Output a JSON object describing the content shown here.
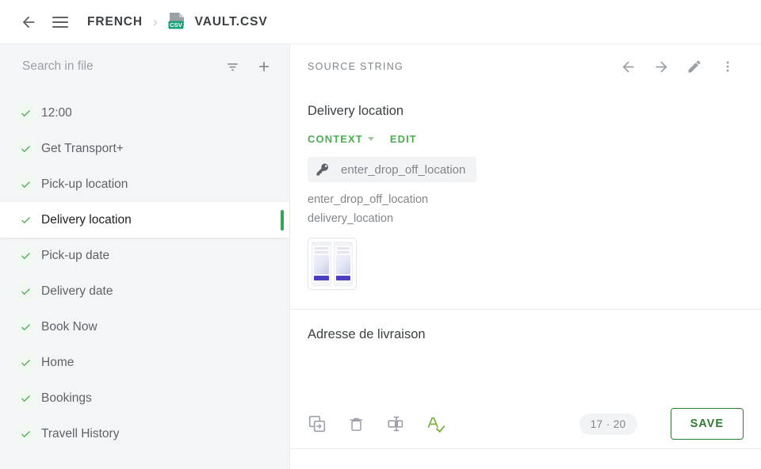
{
  "colors": {
    "accent_green": "#34a853",
    "context_green": "#4caf50",
    "save_green": "#2e7d32",
    "sidebar_bg": "#f4f5f7",
    "text_primary": "#3c4043",
    "text_secondary": "#80868b",
    "csv_badge": "#1aa179",
    "phone_button_purple": "#4a3fc4"
  },
  "topbar": {
    "back_icon": "back-arrow-icon",
    "menu_icon": "hamburger-menu-icon",
    "breadcrumb": {
      "project": "FRENCH",
      "separator": "›",
      "file": "VAULT.CSV",
      "file_icon": "csv-file-icon",
      "file_icon_badge": "CSV"
    }
  },
  "sidebar": {
    "search": {
      "placeholder": "Search in file",
      "value": ""
    },
    "filter_icon": "filter-icon",
    "add_icon": "plus-icon",
    "items": [
      {
        "label": "12:00",
        "status": "translated",
        "selected": false
      },
      {
        "label": "Get Transport+",
        "status": "translated",
        "selected": false
      },
      {
        "label": "Pick-up location",
        "status": "translated",
        "selected": false
      },
      {
        "label": "Delivery location",
        "status": "translated",
        "selected": true
      },
      {
        "label": "Pick-up date",
        "status": "translated",
        "selected": false
      },
      {
        "label": "Delivery date",
        "status": "translated",
        "selected": false
      },
      {
        "label": "Book Now",
        "status": "translated",
        "selected": false
      },
      {
        "label": "Home",
        "status": "translated",
        "selected": false
      },
      {
        "label": "Bookings",
        "status": "translated",
        "selected": false
      },
      {
        "label": "Travell History",
        "status": "translated",
        "selected": false
      }
    ]
  },
  "source_panel": {
    "caption": "SOURCE STRING",
    "prev_icon": "arrow-left-icon",
    "next_icon": "arrow-right-icon",
    "edit_icon": "pencil-icon",
    "more_icon": "more-vertical-icon",
    "string": "Delivery location",
    "context": {
      "label": "CONTEXT",
      "caret_icon": "chevron-down-icon",
      "edit_label": "EDIT",
      "key_icon": "key-icon",
      "key_name": "enter_drop_off_location",
      "meta_lines": [
        "enter_drop_off_location",
        "delivery_location"
      ],
      "screenshot_thumbnail": "screenshot-thumbnail"
    }
  },
  "translation_panel": {
    "text": "Adresse de livraison",
    "tools": [
      {
        "name": "copy-source-icon"
      },
      {
        "name": "delete-icon"
      },
      {
        "name": "split-segment-icon"
      },
      {
        "name": "spellcheck-icon"
      }
    ],
    "counter": "17 · 20",
    "save_label": "SAVE"
  }
}
